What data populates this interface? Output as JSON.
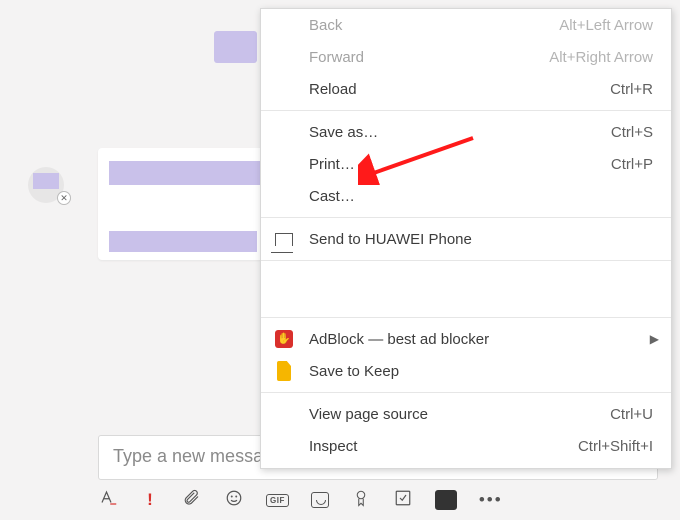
{
  "chat": {
    "compose_placeholder": "Type a new message"
  },
  "toolbar": {
    "gif_label": "GIF"
  },
  "menu": {
    "items": [
      {
        "label": "Back",
        "shortcut": "Alt+Left Arrow",
        "disabled": true
      },
      {
        "label": "Forward",
        "shortcut": "Alt+Right Arrow",
        "disabled": true
      },
      {
        "label": "Reload",
        "shortcut": "Ctrl+R"
      }
    ],
    "items2": [
      {
        "label": "Save as…",
        "shortcut": "Ctrl+S"
      },
      {
        "label": "Print…",
        "shortcut": "Ctrl+P"
      },
      {
        "label": "Cast…",
        "shortcut": ""
      }
    ],
    "huawei": {
      "label": "Send to HUAWEI Phone"
    },
    "ext": [
      {
        "label": "AdBlock — best ad blocker",
        "submenu": true
      },
      {
        "label": "Save to Keep"
      }
    ],
    "dev": [
      {
        "label": "View page source",
        "shortcut": "Ctrl+U"
      },
      {
        "label": "Inspect",
        "shortcut": "Ctrl+Shift+I"
      }
    ]
  }
}
